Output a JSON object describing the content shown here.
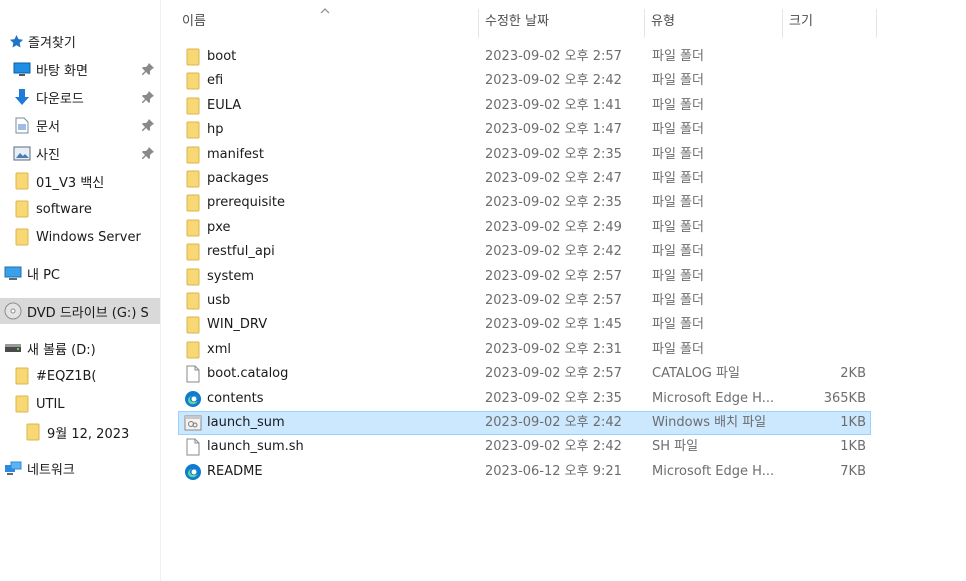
{
  "colors": {
    "folder": "#f8d775",
    "selected_row": "#cce8ff",
    "selected_border": "#99d1ff",
    "sidebar_selected": "#d9d9d9",
    "star": "#1e74c8",
    "edge": "#0f7ccf"
  },
  "columns": {
    "name": "이름",
    "modified": "수정한 날짜",
    "type": "유형",
    "size": "크기"
  },
  "sidebar": {
    "items": [
      {
        "label": "즐겨찾기",
        "icon": "star-icon",
        "pinned": false
      },
      {
        "label": "바탕 화면",
        "icon": "desktop-icon",
        "pinned": true
      },
      {
        "label": "다운로드",
        "icon": "download-icon",
        "pinned": true
      },
      {
        "label": "문서",
        "icon": "document-icon",
        "pinned": true
      },
      {
        "label": "사진",
        "icon": "pictures-icon",
        "pinned": true
      },
      {
        "label": "01_V3 백신",
        "icon": "folder-icon",
        "pinned": false
      },
      {
        "label": "software",
        "icon": "folder-icon",
        "pinned": false
      },
      {
        "label": "Windows Server",
        "icon": "folder-icon",
        "pinned": false
      },
      {
        "label": "내 PC",
        "icon": "pc-icon",
        "pinned": false
      },
      {
        "label": "DVD 드라이브 (G:) S",
        "icon": "dvd-icon",
        "pinned": false,
        "selected": true
      },
      {
        "label": "새 볼륨 (D:)",
        "icon": "drive-icon",
        "pinned": false
      },
      {
        "label": "#EQZ1B(",
        "icon": "folder-icon",
        "pinned": false
      },
      {
        "label": "UTIL",
        "icon": "folder-icon",
        "pinned": false
      },
      {
        "label": "9월 12, 2023",
        "icon": "folder-icon",
        "pinned": false
      },
      {
        "label": "네트워크",
        "icon": "network-icon",
        "pinned": false
      }
    ]
  },
  "files": [
    {
      "name": "boot",
      "date": "2023-09-02 오후 2:57",
      "type": "파일 폴더",
      "size": "",
      "icon": "folder-icon"
    },
    {
      "name": "efi",
      "date": "2023-09-02 오후 2:42",
      "type": "파일 폴더",
      "size": "",
      "icon": "folder-icon"
    },
    {
      "name": "EULA",
      "date": "2023-09-02 오후 1:41",
      "type": "파일 폴더",
      "size": "",
      "icon": "folder-icon"
    },
    {
      "name": "hp",
      "date": "2023-09-02 오후 1:47",
      "type": "파일 폴더",
      "size": "",
      "icon": "folder-icon"
    },
    {
      "name": "manifest",
      "date": "2023-09-02 오후 2:35",
      "type": "파일 폴더",
      "size": "",
      "icon": "folder-icon"
    },
    {
      "name": "packages",
      "date": "2023-09-02 오후 2:47",
      "type": "파일 폴더",
      "size": "",
      "icon": "folder-icon"
    },
    {
      "name": "prerequisite",
      "date": "2023-09-02 오후 2:35",
      "type": "파일 폴더",
      "size": "",
      "icon": "folder-icon"
    },
    {
      "name": "pxe",
      "date": "2023-09-02 오후 2:49",
      "type": "파일 폴더",
      "size": "",
      "icon": "folder-icon"
    },
    {
      "name": "restful_api",
      "date": "2023-09-02 오후 2:42",
      "type": "파일 폴더",
      "size": "",
      "icon": "folder-icon"
    },
    {
      "name": "system",
      "date": "2023-09-02 오후 2:57",
      "type": "파일 폴더",
      "size": "",
      "icon": "folder-icon"
    },
    {
      "name": "usb",
      "date": "2023-09-02 오후 2:57",
      "type": "파일 폴더",
      "size": "",
      "icon": "folder-icon"
    },
    {
      "name": "WIN_DRV",
      "date": "2023-09-02 오후 1:45",
      "type": "파일 폴더",
      "size": "",
      "icon": "folder-icon"
    },
    {
      "name": "xml",
      "date": "2023-09-02 오후 2:31",
      "type": "파일 폴더",
      "size": "",
      "icon": "folder-icon"
    },
    {
      "name": "boot.catalog",
      "date": "2023-09-02 오후 2:57",
      "type": "CATALOG 파일",
      "size": "2KB",
      "icon": "file-icon"
    },
    {
      "name": "contents",
      "date": "2023-09-02 오후 2:35",
      "type": "Microsoft Edge H...",
      "size": "365KB",
      "icon": "edge-icon"
    },
    {
      "name": "launch_sum",
      "date": "2023-09-02 오후 2:42",
      "type": "Windows 배치 파일",
      "size": "1KB",
      "icon": "batch-file-icon",
      "selected": true
    },
    {
      "name": "launch_sum.sh",
      "date": "2023-09-02 오후 2:42",
      "type": "SH 파일",
      "size": "1KB",
      "icon": "file-icon"
    },
    {
      "name": "README",
      "date": "2023-06-12 오후 9:21",
      "type": "Microsoft Edge H...",
      "size": "7KB",
      "icon": "edge-icon"
    }
  ]
}
